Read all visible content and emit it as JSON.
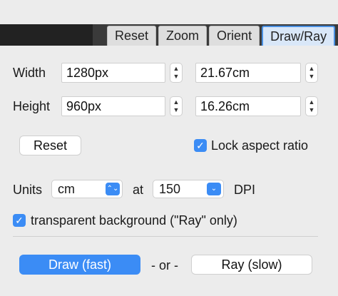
{
  "tabs": [
    {
      "label": "Reset",
      "active": false
    },
    {
      "label": "Zoom",
      "active": false
    },
    {
      "label": "Orient",
      "active": false
    },
    {
      "label": "Draw/Ray",
      "active": true
    }
  ],
  "size": {
    "width_label": "Width",
    "height_label": "Height",
    "width_px": "1280px",
    "width_cm": "21.67cm",
    "height_px": "960px",
    "height_cm": "16.26cm"
  },
  "actions": {
    "reset_label": "Reset",
    "lock_aspect_label": "Lock aspect ratio",
    "lock_aspect_checked": true
  },
  "units": {
    "units_label": "Units",
    "unit_value": "cm",
    "at_label": "at",
    "dpi_value": "150",
    "dpi_label": "DPI"
  },
  "transparent": {
    "label": "transparent background (\"Ray\" only)",
    "checked": true
  },
  "draw": {
    "draw_label": "Draw (fast)",
    "or_label": "- or -",
    "ray_label": "Ray (slow)"
  },
  "colors": {
    "accent": "#3b8cf5",
    "tab_active_border": "#4a90e2"
  },
  "icons": {
    "stepper_up": "▲",
    "stepper_down": "▼",
    "check": "✓",
    "select_arrows": "⌃⌄",
    "dropdown": "⌄"
  }
}
